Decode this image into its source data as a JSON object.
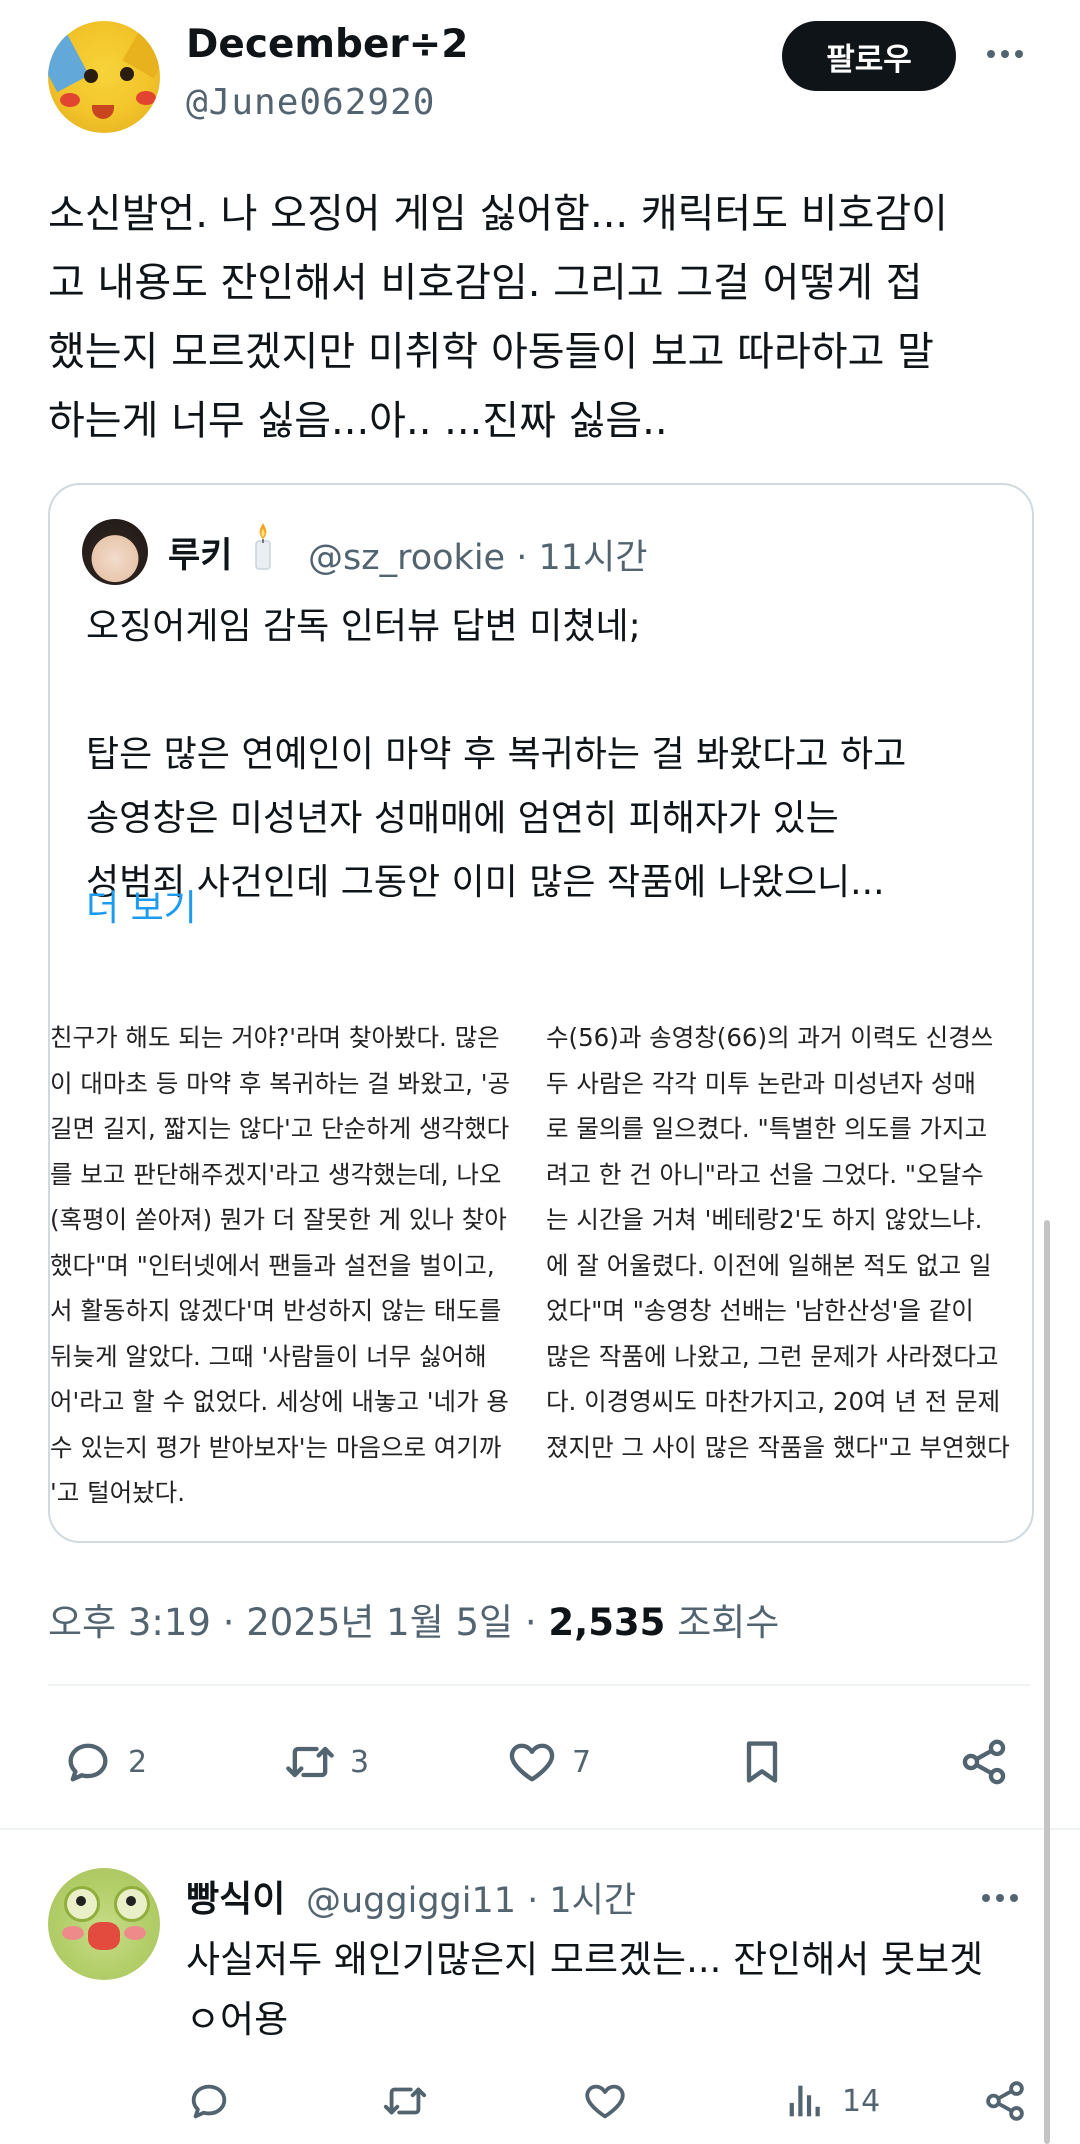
{
  "post": {
    "author_name": "December÷2",
    "author_handle": "@June062920",
    "follow_label": "팔로우",
    "text_lines": [
      "소신발언. 나 오징어 게임 싫어함... 캐릭터도 비호감이",
      "고 내용도 잔인해서 비호감임. 그리고 그걸 어떻게 접",
      "했는지 모르겠지만 미취학 아동들이 보고 따라하고 말",
      "하는게 너무 싫음...아.. ...진짜 싫음.."
    ],
    "meta_time": "오후 3:19 · 2025년 1월 5일 · ",
    "views_count": "2,535",
    "views_label": " 조회수",
    "replies": "2",
    "reposts": "3",
    "likes": "7"
  },
  "quote": {
    "author_name": "루키",
    "author_handle": "@sz_rookie · 11시간",
    "text_lines": [
      "오징어게임 감독 인터뷰 답변 미쳤네;",
      "",
      "탑은 많은 연예인이 마약 후 복귀하는 걸 봐왔다고 하고",
      "송영창은 미성년자 성매매에 엄연히 피해자가 있는",
      "성범죄 사건인데 그동안 이미 많은 작품에 나왔으니..."
    ],
    "show_more": "더 보기",
    "article_left": [
      "친구가 해도 되는 거야?'라며 찾아봤다. 많은",
      "이 대마초 등 마약 후 복귀하는 걸 봐왔고, '공",
      " 길면 길지, 짧지는 않다'고 단순하게 생각했다",
      "를 보고 판단해주겠지'라고 생각했는데, 나오",
      " (혹평이 쏟아져) 뭔가 더 잘못한 게 있나 찾아",
      "했다\"며 \"인터넷에서 팬들과 설전을 벌이고,",
      "서 활동하지 않겠다'며 반성하지 않는 태도를",
      " 뒤늦게 알았다. 그때 '사람들이 너무 싫어해",
      "어'라고 할 수 없었다. 세상에 내놓고 '네가 용",
      " 수 있는지 평가 받아보자'는 마음으로 여기까",
      "'고 털어놨다."
    ],
    "article_right": [
      "수(56)과 송영창(66)의 과거 이력도 신경쓰",
      " 두 사람은 각각 미투 논란과 미성년자 성매",
      "로 물의를 일으켰다. \"특별한 의도를 가지고",
      "려고 한 건 아니\"라고 선을 그었다. \"오달수",
      "는 시간을 거쳐 '베테랑2'도 하지 않았느냐.",
      "에 잘 어울렸다. 이전에 일해본 적도 없고 일",
      "었다\"며 \"송영창 선배는 '남한산성'을 같이",
      "많은 작품에 나왔고, 그런 문제가 사라졌다고",
      "다. 이경영씨도 마찬가지고, 20여 년 전 문제",
      "졌지만 그 사이 많은 작품을 했다\"고 부연했다"
    ]
  },
  "reply": {
    "author_name": "빵식이",
    "author_handle": "@uggiggi11 · 1시간",
    "text_lines": [
      "사실저두 왜인기많은지 모르겠는... 잔인해서 못보겟",
      "ㅇ어용"
    ],
    "views": "14"
  },
  "icons": [
    "reply-icon",
    "repost-icon",
    "like-icon",
    "bookmark-icon",
    "share-icon",
    "views-icon",
    "more-icon",
    "candle-icon"
  ],
  "colors": {
    "text": "#0f1419",
    "muted": "#536471",
    "link": "#1d9bf0",
    "border": "#cfd9de"
  }
}
